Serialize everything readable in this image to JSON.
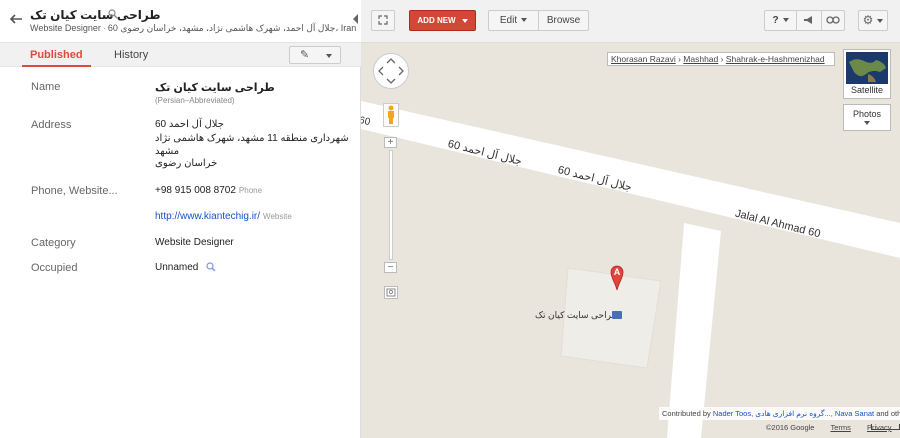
{
  "place": {
    "title": "طراحی سایت کیان تک",
    "category_short": "Website Designer",
    "subtitle_addr": "60 جلال آل احمد، شهرک هاشمی نژاد، مشهد، خراسان رضوی، Iran"
  },
  "tabs": {
    "published": "Published",
    "history": "History"
  },
  "fields": {
    "name_label": "Name",
    "name_value": "طراحی سایت کیان تک",
    "name_meta": "(Persian–Abbreviated)",
    "address_label": "Address",
    "address_lines": [
      "جلال آل احمد 60",
      "شهرداری منطقه 11 مشهد، شهرک هاشمی نژاد",
      "مشهد",
      "خراسان رضوی"
    ],
    "phone_label": "Phone, Website...",
    "phone_value": "+98 915 008 8702",
    "phone_kind": "Phone",
    "website_value": "http://www.kiantechig.ir/",
    "website_kind": "Website",
    "category_label": "Category",
    "category_value": "Website Designer",
    "occupied_label": "Occupied",
    "occupied_value": "Unnamed"
  },
  "toolbar": {
    "add_new": "ADD NEW",
    "edit": "Edit",
    "browse": "Browse",
    "help": "?"
  },
  "map": {
    "breadcrumb": [
      "Khorasan Razavi",
      "Mashhad",
      "Shahrak-e-Hashmenizhad"
    ],
    "satellite_label": "Satellite",
    "photos_label": "Photos",
    "road_label_1": "جلال آل احمد 60",
    "road_label_2": "جلال آل احمد 60",
    "road_label_en": "Jalal Al Ahmad 60",
    "road_label_edge": "60",
    "marker_letter": "A",
    "poi_label": "طراحی سایت کیان تک",
    "attribution_prefix": "Contributed by",
    "attribution_1": "Nader Toos",
    "attribution_2": "گروه نرم افزاری هادی...",
    "attribution_3": "Nava Sanat",
    "attribution_suffix": "and others",
    "copyright": "©2016 Google",
    "terms": "Terms",
    "privacy": "Privacy"
  },
  "colors": {
    "accent": "#dd4b39",
    "map_bg": "#e9e5dc",
    "road": "#ffffff",
    "link": "#1155cc"
  }
}
